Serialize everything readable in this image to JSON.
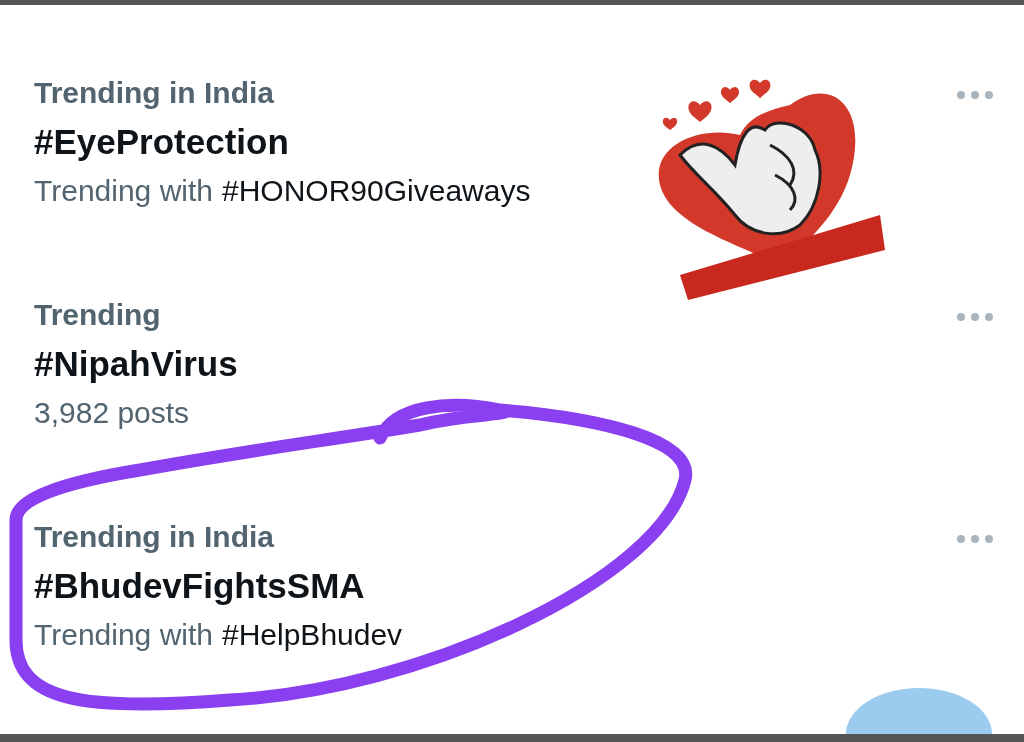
{
  "trends": [
    {
      "category": "Trending in India",
      "title": "#EyeProtection",
      "context": {
        "text": "Trending with",
        "tag": "#HONOR90Giveaways"
      }
    },
    {
      "category": "Trending",
      "title": "#NipahVirus",
      "context": {
        "text": "3,982 posts"
      }
    },
    {
      "category": "Trending in India",
      "title": "#BhudevFightsSMA",
      "context": {
        "text": "Trending with",
        "tag": "#HelpBhudev"
      }
    }
  ],
  "annotation": {
    "kind": "loop"
  }
}
